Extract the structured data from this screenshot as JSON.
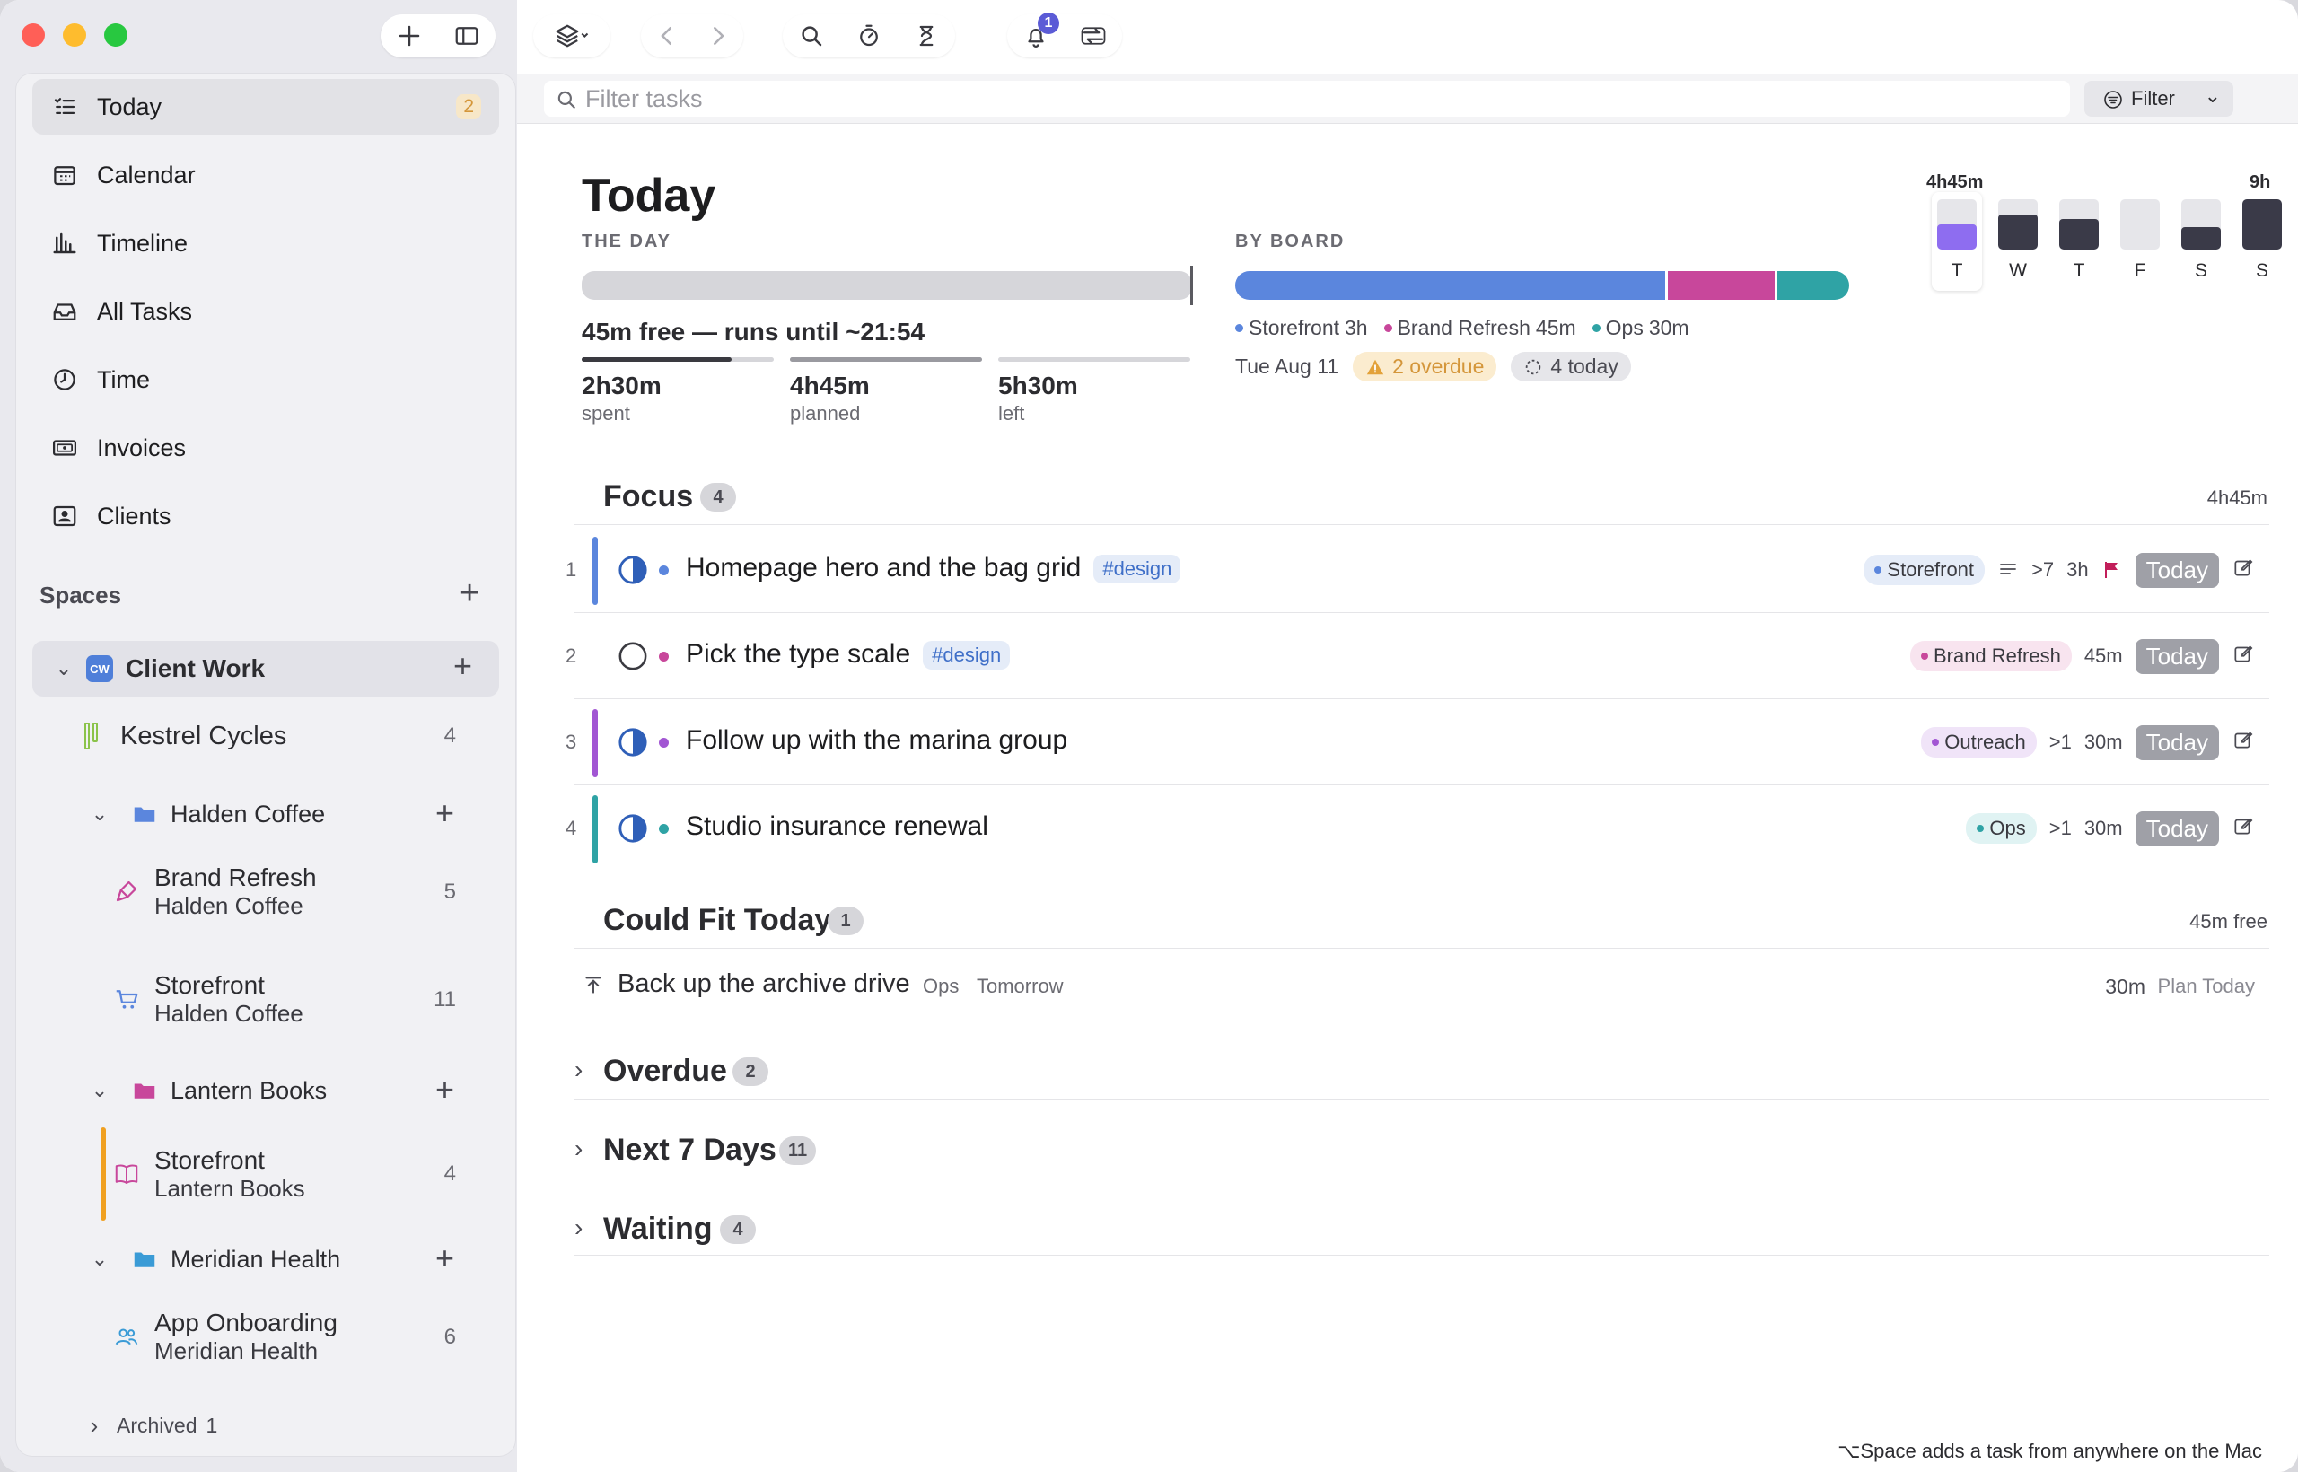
{
  "toolbar": {
    "notifications_badge": "1"
  },
  "filter": {
    "placeholder": "Filter tasks",
    "button_label": "Filter"
  },
  "nav": {
    "items": [
      {
        "label": "Today",
        "icon": "today-list-icon",
        "badge": "2"
      },
      {
        "label": "Calendar",
        "icon": "calendar-icon"
      },
      {
        "label": "Timeline",
        "icon": "timeline-icon"
      },
      {
        "label": "All Tasks",
        "icon": "inbox-tray-icon"
      },
      {
        "label": "Time",
        "icon": "clock-icon"
      },
      {
        "label": "Invoices",
        "icon": "invoice-icon"
      },
      {
        "label": "Clients",
        "icon": "person-card-icon"
      }
    ]
  },
  "spaces": {
    "heading": "Spaces",
    "workspace": {
      "label": "Client Work",
      "initials": "CW"
    },
    "tree": [
      {
        "label": "Kestrel Cycles",
        "count": "4"
      },
      {
        "label": "Halden Coffee",
        "type": "folder"
      },
      {
        "label": "Brand Refresh",
        "sub": "Halden Coffee",
        "count": "5"
      },
      {
        "label": "Storefront",
        "sub": "Halden Coffee",
        "count": "11"
      },
      {
        "label": "Lantern Books",
        "type": "folder"
      },
      {
        "label": "Storefront",
        "sub": "Lantern Books",
        "count": "4"
      },
      {
        "label": "Meridian Health",
        "type": "folder"
      },
      {
        "label": "App Onboarding",
        "sub": "Meridian Health",
        "count": "6"
      }
    ],
    "archived": {
      "label": "Archived",
      "count": "1"
    }
  },
  "today": {
    "title": "Today",
    "the_day_caption": "THE DAY",
    "free_text": "45m free — runs until ~21:54",
    "stats": [
      {
        "value": "2h30m",
        "label": "spent",
        "fill": 0.78
      },
      {
        "value": "4h45m",
        "label": "planned",
        "fill": 1.0
      },
      {
        "value": "5h30m",
        "label": "left",
        "fill": 0.0
      }
    ],
    "by_board_caption": "BY BOARD",
    "boards": [
      {
        "name": "Storefront",
        "duration": "3h",
        "color": "#5b86dd",
        "minutes": 180
      },
      {
        "name": "Brand Refresh",
        "duration": "45m",
        "color": "#c8479b",
        "minutes": 45
      },
      {
        "name": "Ops",
        "duration": "30m",
        "color": "#2fa3a5",
        "minutes": 30
      }
    ],
    "date": "Tue Aug 11",
    "overdue_chip": "2 overdue",
    "today_chip": "4 today",
    "week": {
      "max_label": "9h",
      "current_label": "4h45m",
      "days": [
        {
          "day": "T",
          "fill": 0.5,
          "current": true
        },
        {
          "day": "W",
          "fill": 0.7
        },
        {
          "day": "T",
          "fill": 0.6
        },
        {
          "day": "F",
          "fill": 0.0
        },
        {
          "day": "S",
          "fill": 0.45
        },
        {
          "day": "S",
          "fill": 1.0
        }
      ]
    }
  },
  "focus": {
    "title": "Focus",
    "count": "4",
    "total": "4h45m",
    "tasks": [
      {
        "num": "1",
        "title": "Homepage hero and the bag grid",
        "tag": "#design",
        "board": "Storefront",
        "board_color": "#5b86dd",
        "board_bg": "#e5ecf8",
        "subtasks": ">7",
        "duration": "3h",
        "flag": true,
        "notes": true,
        "btn": "Today",
        "accent": "#5b86dd",
        "status": "half"
      },
      {
        "num": "2",
        "title": "Pick the type scale",
        "tag": "#design",
        "board": "Brand Refresh",
        "board_color": "#c8479b",
        "board_bg": "#f8e4ef",
        "duration": "45m",
        "btn": "Today",
        "accent": "",
        "status": "empty"
      },
      {
        "num": "3",
        "title": "Follow up with the marina group",
        "board": "Outreach",
        "board_color": "#a256d3",
        "board_bg": "#f0e4f8",
        "subtasks": ">1",
        "duration": "30m",
        "btn": "Today",
        "accent": "#a256d3",
        "status": "half"
      },
      {
        "num": "4",
        "title": "Studio insurance renewal",
        "board": "Ops",
        "board_color": "#2fa3a5",
        "board_bg": "#e0f3f3",
        "subtasks": ">1",
        "duration": "30m",
        "btn": "Today",
        "accent": "#2fa3a5",
        "status": "half"
      }
    ]
  },
  "could_fit": {
    "title": "Could Fit Today",
    "count": "1",
    "free": "45m free",
    "task": {
      "title": "Back up the archive drive",
      "board": "Ops",
      "when": "Tomorrow",
      "duration": "30m",
      "action": "Plan Today"
    }
  },
  "collapsed_sections": [
    {
      "title": "Overdue",
      "count": "2"
    },
    {
      "title": "Next 7 Days",
      "count": "11"
    },
    {
      "title": "Waiting",
      "count": "4"
    }
  ],
  "footer_hint": "⌥Space adds a task from anywhere on the Mac"
}
